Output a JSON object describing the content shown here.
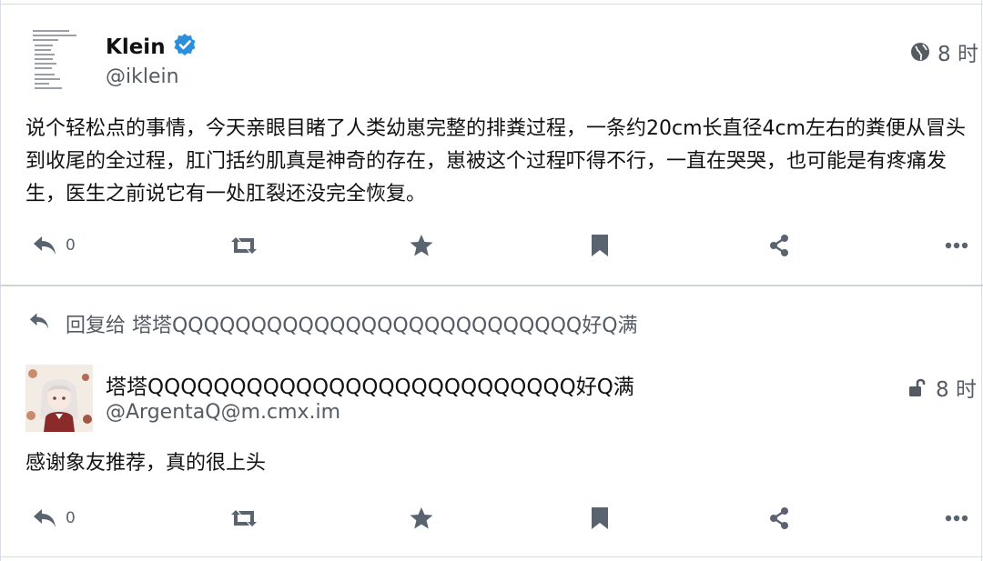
{
  "posts": [
    {
      "author_name": "Klein",
      "verified": true,
      "handle": "@iklein",
      "time": "8 时",
      "visibility_icon": "globe-icon",
      "content": "说个轻松点的事情，今天亲眼目睹了人类幼崽完整的排粪过程，一条约20cm长直径4cm左右的粪便从冒头到收尾的全过程，肛门括约肌真是神奇的存在，崽被这个过程吓得不行，一直在哭哭，也可能是有疼痛发生，医生之前说它有一处肛裂还没完全恢复。",
      "reply_count": "0"
    },
    {
      "reply_to_label": "回复给 塔塔QQQQQQQQQQQQQQQQQQQQQQQQQQ好Q满",
      "author_name": "塔塔QQQQQQQQQQQQQQQQQQQQQQQQQQ好Q满",
      "handle": "@ArgentaQ@m.cmx.im",
      "time": "8 时",
      "visibility_icon": "unlock-icon",
      "content": "感谢象友推荐，真的很上头",
      "reply_count": "0"
    }
  ],
  "colors": {
    "verified": "#2b90d9",
    "icon": "#5a6370",
    "border": "#d9dde3"
  }
}
